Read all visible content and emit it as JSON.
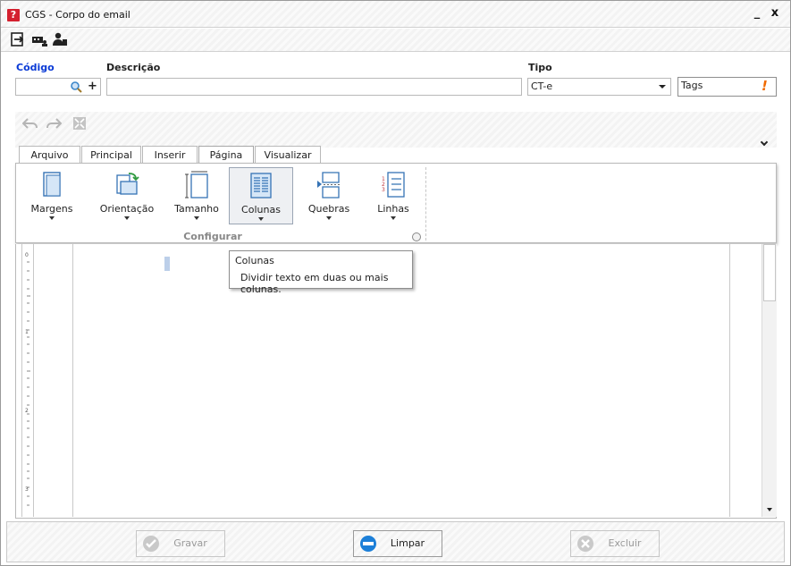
{
  "window": {
    "title": "CGS - Corpo do email",
    "minimize": "_",
    "close": "x"
  },
  "form": {
    "codigo_label": "Código",
    "codigo_value": "",
    "descricao_label": "Descrição",
    "descricao_value": "",
    "tipo_label": "Tipo",
    "tipo_value": "CT-e",
    "tags_label": "Tags",
    "tags_warning": "!"
  },
  "ribbon": {
    "tabs": [
      "Arquivo",
      "Principal",
      "Inserir",
      "Página",
      "Visualizar"
    ],
    "active_tab": "Página",
    "buttons": [
      "Margens",
      "Orientação",
      "Tamanho",
      "Colunas",
      "Quebras",
      "Linhas"
    ],
    "group_label": "Configurar"
  },
  "tooltip": {
    "title": "Colunas",
    "description": "Dividir texto em duas ou mais colunas."
  },
  "ruler": {
    "marks": [
      "0",
      "1",
      "2",
      "3"
    ]
  },
  "footer": {
    "save": "Gravar",
    "clear": "Limpar",
    "delete": "Excluir"
  },
  "colors": {
    "accent": "#0a3ad6",
    "brand": "#d4202f",
    "warning": "#f06a00"
  }
}
